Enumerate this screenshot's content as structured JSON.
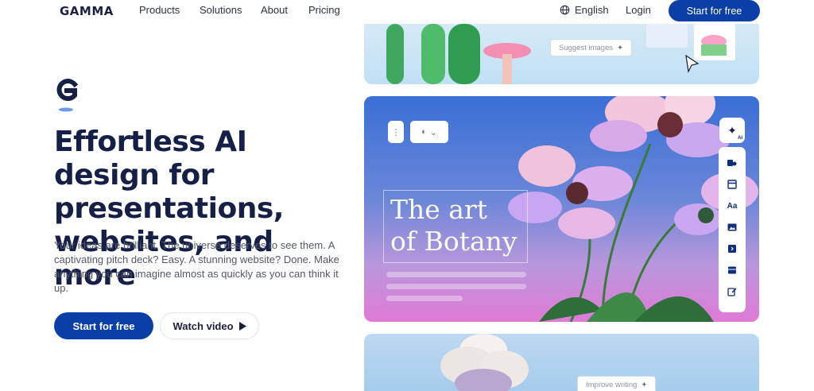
{
  "nav": {
    "logo": "GAMMA",
    "links": [
      "Products",
      "Solutions",
      "About",
      "Pricing"
    ],
    "language": "English",
    "login": "Login",
    "cta": "Start for free"
  },
  "hero": {
    "headline": "Effortless AI design for presentations, websites, and more",
    "subcopy": "Your ideas are brilliant. The universe deserves to see them. A captivating pitch deck? Easy. A stunning website? Done. Make anything you can imagine almost as quickly as you can think it up.",
    "primary_cta": "Start for free",
    "secondary_cta": "Watch video"
  },
  "preview": {
    "suggest_label": "Suggest images",
    "improve_label": "Improve writing",
    "slide_title_line1": "The art",
    "slide_title_line2": "of Botany",
    "toolbar_text_tool": "Aa",
    "ai_badge": "AI"
  },
  "colors": {
    "brand_blue": "#0a3fa8",
    "headline": "#162046"
  }
}
